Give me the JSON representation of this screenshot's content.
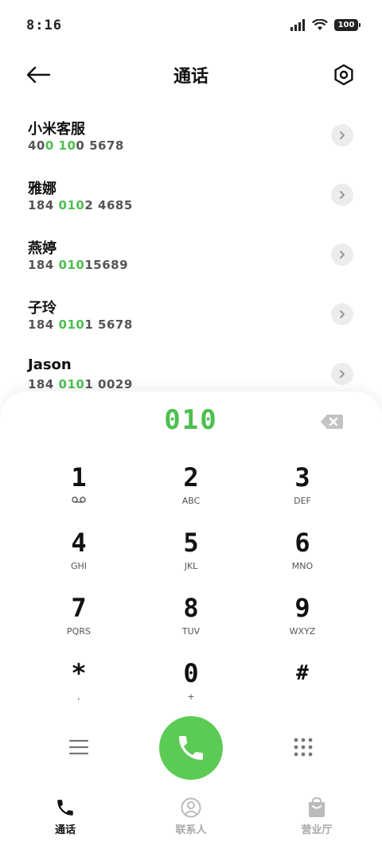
{
  "status": {
    "time": "8:16",
    "battery": "100"
  },
  "header": {
    "title": "通话"
  },
  "contacts": [
    {
      "name": "小米客服",
      "number_parts": [
        "40",
        "0 10",
        "0 5678"
      ]
    },
    {
      "name": "雅娜",
      "number_parts": [
        "184 ",
        "010",
        "2 4685"
      ]
    },
    {
      "name": "燕婷",
      "number_parts": [
        "184 ",
        "010",
        "15689"
      ]
    },
    {
      "name": "子玲",
      "number_parts": [
        "184 ",
        "010",
        "1 5678"
      ]
    },
    {
      "name": "Jason",
      "number_parts": [
        "184 ",
        "010",
        "1 0029"
      ]
    }
  ],
  "dialer": {
    "input": "010",
    "keys": [
      {
        "digit": "1",
        "letters": ""
      },
      {
        "digit": "2",
        "letters": "ABC"
      },
      {
        "digit": "3",
        "letters": "DEF"
      },
      {
        "digit": "4",
        "letters": "GHI"
      },
      {
        "digit": "5",
        "letters": "JKL"
      },
      {
        "digit": "6",
        "letters": "MNO"
      },
      {
        "digit": "7",
        "letters": "PQRS"
      },
      {
        "digit": "8",
        "letters": "TUV"
      },
      {
        "digit": "9",
        "letters": "WXYZ"
      },
      {
        "digit": "*",
        "letters": ","
      },
      {
        "digit": "0",
        "letters": "+"
      },
      {
        "digit": "#",
        "letters": ""
      }
    ]
  },
  "bottom_nav": {
    "items": [
      {
        "label": "通话",
        "icon": "phone-icon",
        "active": true
      },
      {
        "label": "联系人",
        "icon": "person-icon",
        "active": false
      },
      {
        "label": "营业厅",
        "icon": "shopping-bag-icon",
        "active": false
      }
    ]
  },
  "colors": {
    "accent": "#4cbf4f",
    "call_button": "#5ccb55"
  }
}
